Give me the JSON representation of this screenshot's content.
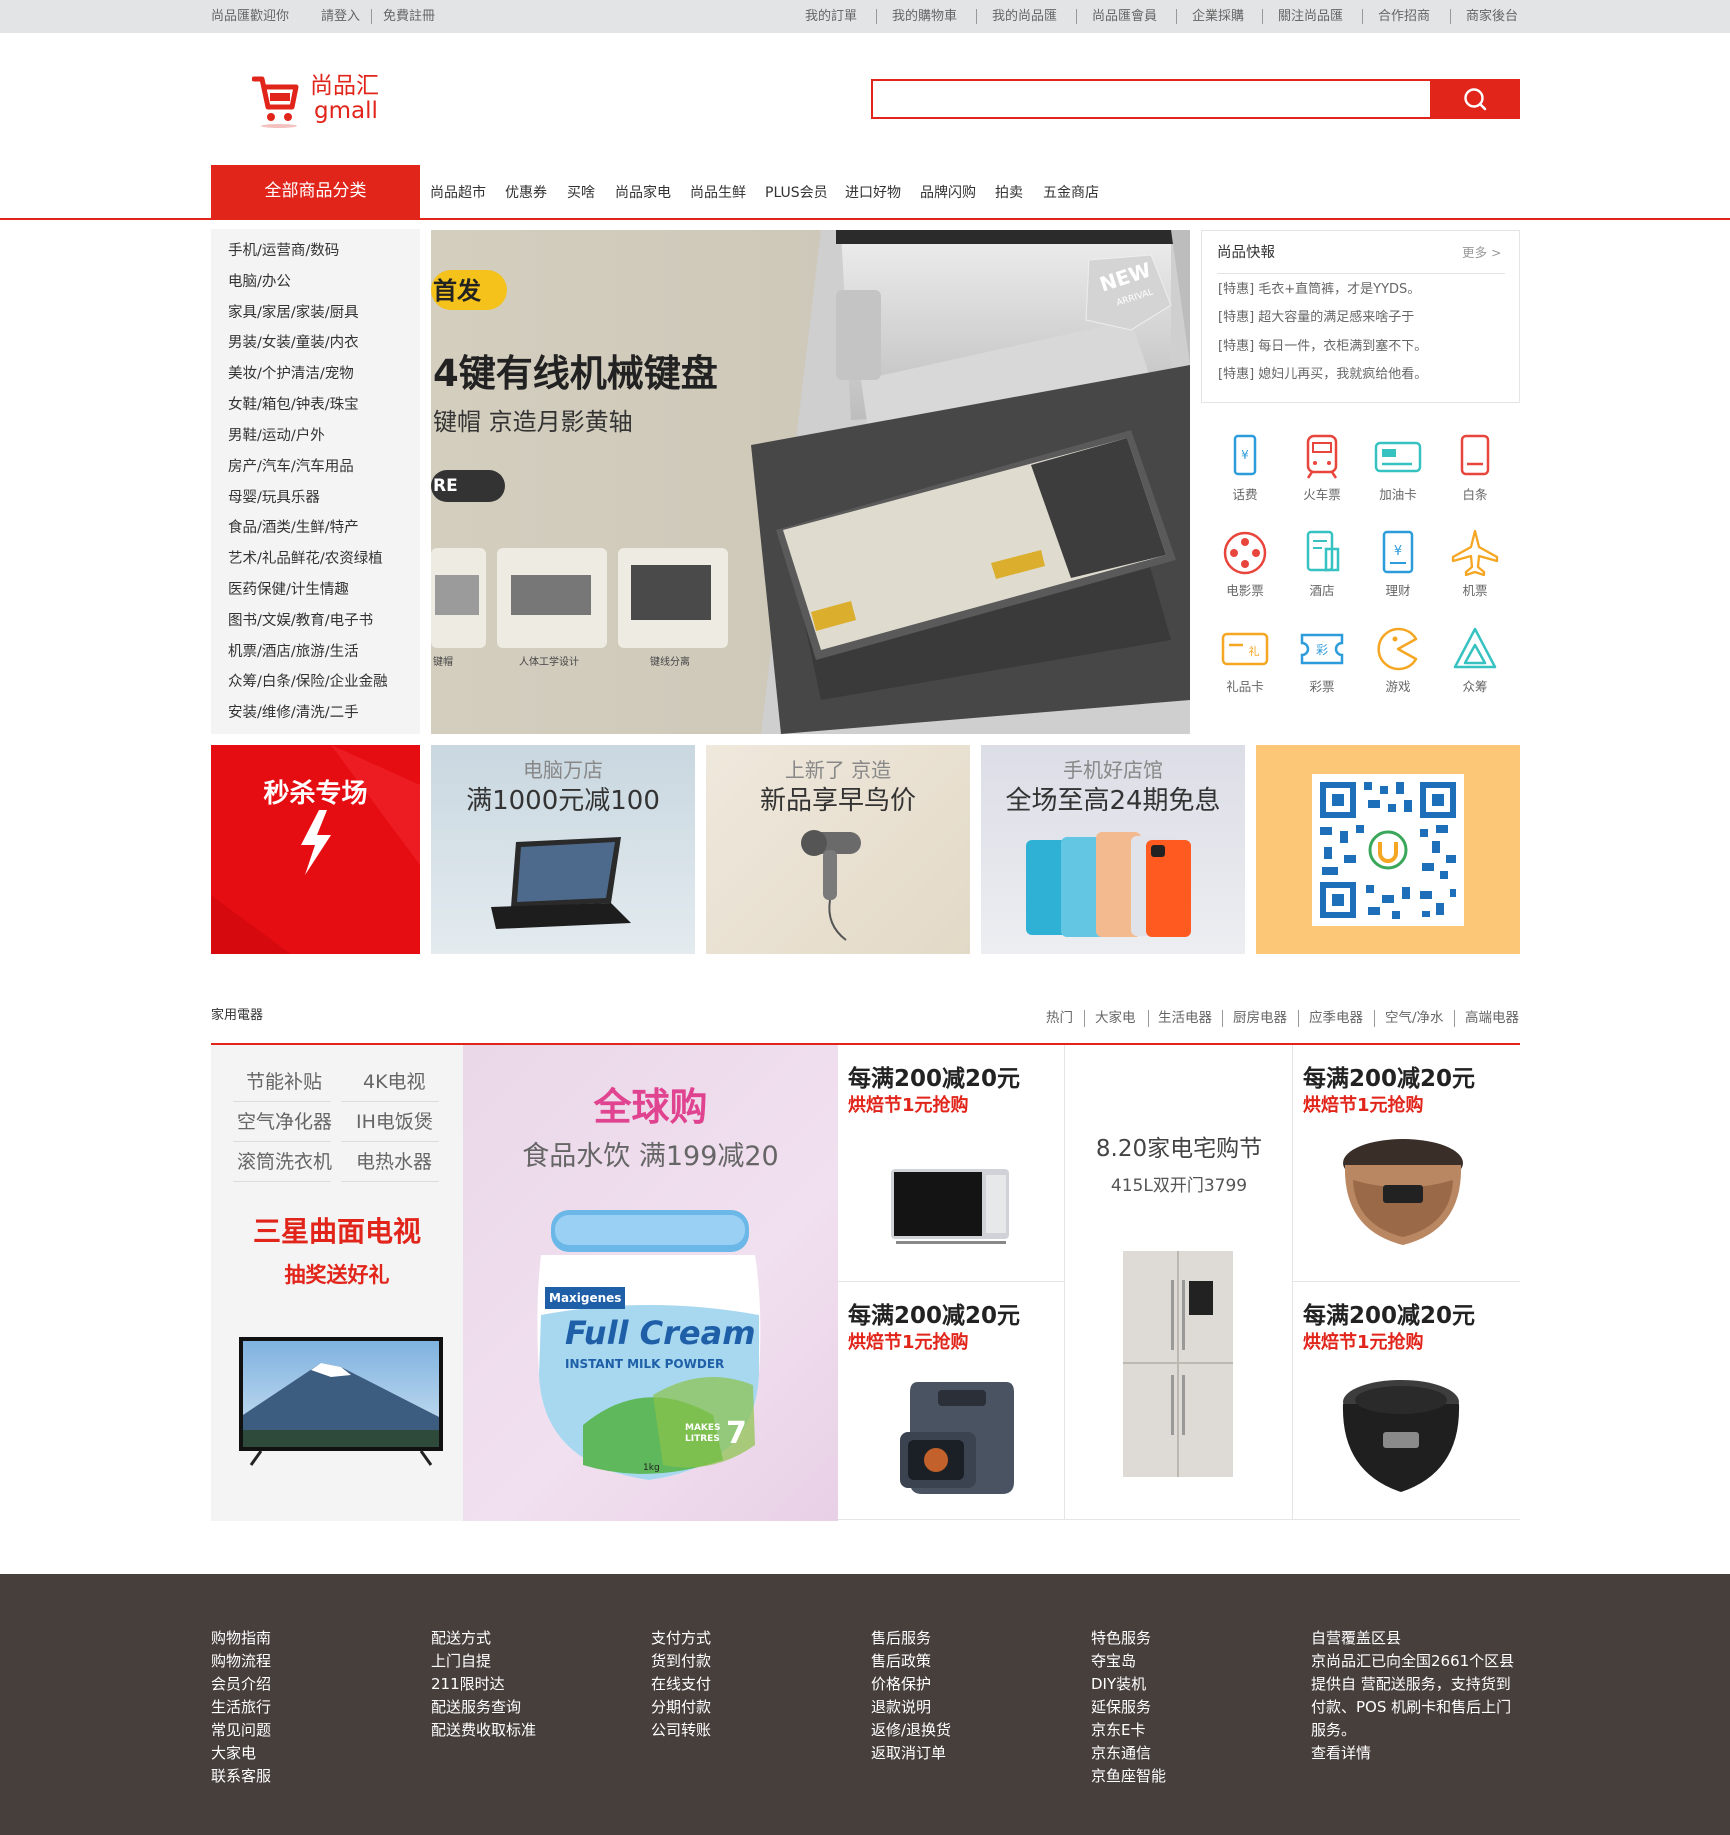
{
  "topbar": {
    "welcome": "尚品匯歡迎你",
    "login": "請登入",
    "register": "免費註冊",
    "links": [
      "我的訂單",
      "我的購物車",
      "我的尚品匯",
      "尚品匯會員",
      "企業採購",
      "關注尚品匯",
      "合作招商",
      "商家後台"
    ]
  },
  "logo": {
    "cn": "尚品汇",
    "en": "gmall"
  },
  "search": {
    "value": "",
    "placeholder": ""
  },
  "nav": {
    "all_categories": "全部商品分类",
    "items": [
      "尚品超市",
      "优惠券",
      "买啥",
      "尚品家电",
      "尚品生鲜",
      "PLUS会员",
      "进口好物",
      "品牌闪购",
      "拍卖",
      "五金商店"
    ]
  },
  "categories": [
    "手机/运营商/数码",
    "电脑/办公",
    "家具/家居/家装/厨具",
    "男装/女装/童装/内衣",
    "美妆/个护清洁/宠物",
    "女鞋/箱包/钟表/珠宝",
    "男鞋/运动/户外",
    "房产/汽车/汽车用品",
    "母婴/玩具乐器",
    "食品/酒类/生鲜/特产",
    "艺术/礼品鲜花/农资绿植",
    "医药保健/计生情趣",
    "图书/文娱/教育/电子书",
    "机票/酒店/旅游/生活",
    "众筹/白条/保险/企业金融",
    "安装/维修/清洗/二手"
  ],
  "banner": {
    "badge": "首发",
    "title": "4键有线机械键盘",
    "subtitle": "键帽  京造月影黄轴",
    "more": "RE",
    "new_label": "NEW",
    "new_sub": "ARRIVAL",
    "thumbs": [
      "键帽",
      "人体工学设计",
      "键线分离"
    ]
  },
  "news": {
    "title": "尚品快報",
    "more": "更多 >",
    "items": [
      "[特惠] 毛衣+直筒裤，才是YYDS。",
      "[特惠] 超大容量的满足感来啥子于",
      "[特惠] 每日一件，衣柜满到塞不下。",
      "[特惠] 媳妇儿再买，我就疯给他看。"
    ]
  },
  "services": [
    {
      "label": "话费",
      "icon": "phone-icon",
      "color": "#2d9cdb"
    },
    {
      "label": "火车票",
      "icon": "train-icon",
      "color": "#e8453c"
    },
    {
      "label": "加油卡",
      "icon": "fuel-card-icon",
      "color": "#35c2c1"
    },
    {
      "label": "白条",
      "icon": "iou-icon",
      "color": "#e8453c"
    },
    {
      "label": "电影票",
      "icon": "film-reel-icon",
      "color": "#e8453c"
    },
    {
      "label": "酒店",
      "icon": "hotel-icon",
      "color": "#35c2c1"
    },
    {
      "label": "理财",
      "icon": "finance-icon",
      "color": "#2d9cdb"
    },
    {
      "label": "机票",
      "icon": "plane-icon",
      "color": "#f5a623"
    },
    {
      "label": "礼品卡",
      "icon": "gift-card-icon",
      "color": "#f5a623"
    },
    {
      "label": "彩票",
      "icon": "lottery-icon",
      "color": "#2d9cdb"
    },
    {
      "label": "游戏",
      "icon": "game-icon",
      "color": "#f5a623"
    },
    {
      "label": "众筹",
      "icon": "crowdfund-icon",
      "color": "#35c2c1"
    }
  ],
  "promos": {
    "seckill": "秒杀专场",
    "p1": {
      "t1": "电脑万店",
      "t2": "满1000元减100"
    },
    "p2": {
      "t1": "上新了 京造",
      "t2": "新品享早鸟价"
    },
    "p3": {
      "t1": "手机好店馆",
      "t2": "全场至高24期免息"
    }
  },
  "floor": {
    "title": "家用電器",
    "tabs": [
      "热门",
      "大家电",
      "生活电器",
      "厨房电器",
      "应季电器",
      "空气/净水",
      "高端电器"
    ],
    "tags": [
      "节能补贴",
      "4K电视",
      "空气净化器",
      "IH电饭煲",
      "滚筒洗衣机",
      "电热水器"
    ],
    "left_title": "三星曲面电视",
    "left_sub": "抽奖送好礼",
    "mid_title": "全球购",
    "mid_sub": "食品水饮  满199减20",
    "product_brand": "Maxigenes",
    "product_name": "Full Cream",
    "product_desc": "INSTANT MILK POWDER",
    "product_makes": "MAKES LITRES",
    "product_num": "7",
    "product_weight": "1kg",
    "deal_title": "每满200减20元",
    "deal_sub": "烘焙节1元抢购",
    "center_title": "8.20家电宅购节",
    "center_sub": "415L双开门3799"
  },
  "footer": {
    "cols": [
      [
        "购物指南",
        "购物流程",
        "会员介绍",
        "生活旅行",
        "常见问题",
        "大家电",
        "联系客服"
      ],
      [
        "配送方式",
        "上门自提",
        "211限时达",
        "配送服务查询",
        "配送费收取标准"
      ],
      [
        "支付方式",
        "货到付款",
        "在线支付",
        "分期付款",
        "公司转账"
      ],
      [
        "售后服务",
        "售后政策",
        "价格保护",
        "退款说明",
        "返修/退换货",
        "返取消订单"
      ],
      [
        "特色服务",
        "夺宝岛",
        "DIY装机",
        "延保服务",
        "京东E卡",
        "京东通信",
        "京鱼座智能"
      ],
      [
        "自营覆盖区县",
        "京尚品汇已向全国2661个区县",
        "提供自 营配送服务，支持货到",
        "付款、POS 机刷卡和售后上门",
        "服务。",
        "查看详情"
      ]
    ]
  },
  "colors": {
    "brand": "#e1251b",
    "footer_bg": "#473f3c",
    "topbar_bg": "#e3e4e5"
  }
}
